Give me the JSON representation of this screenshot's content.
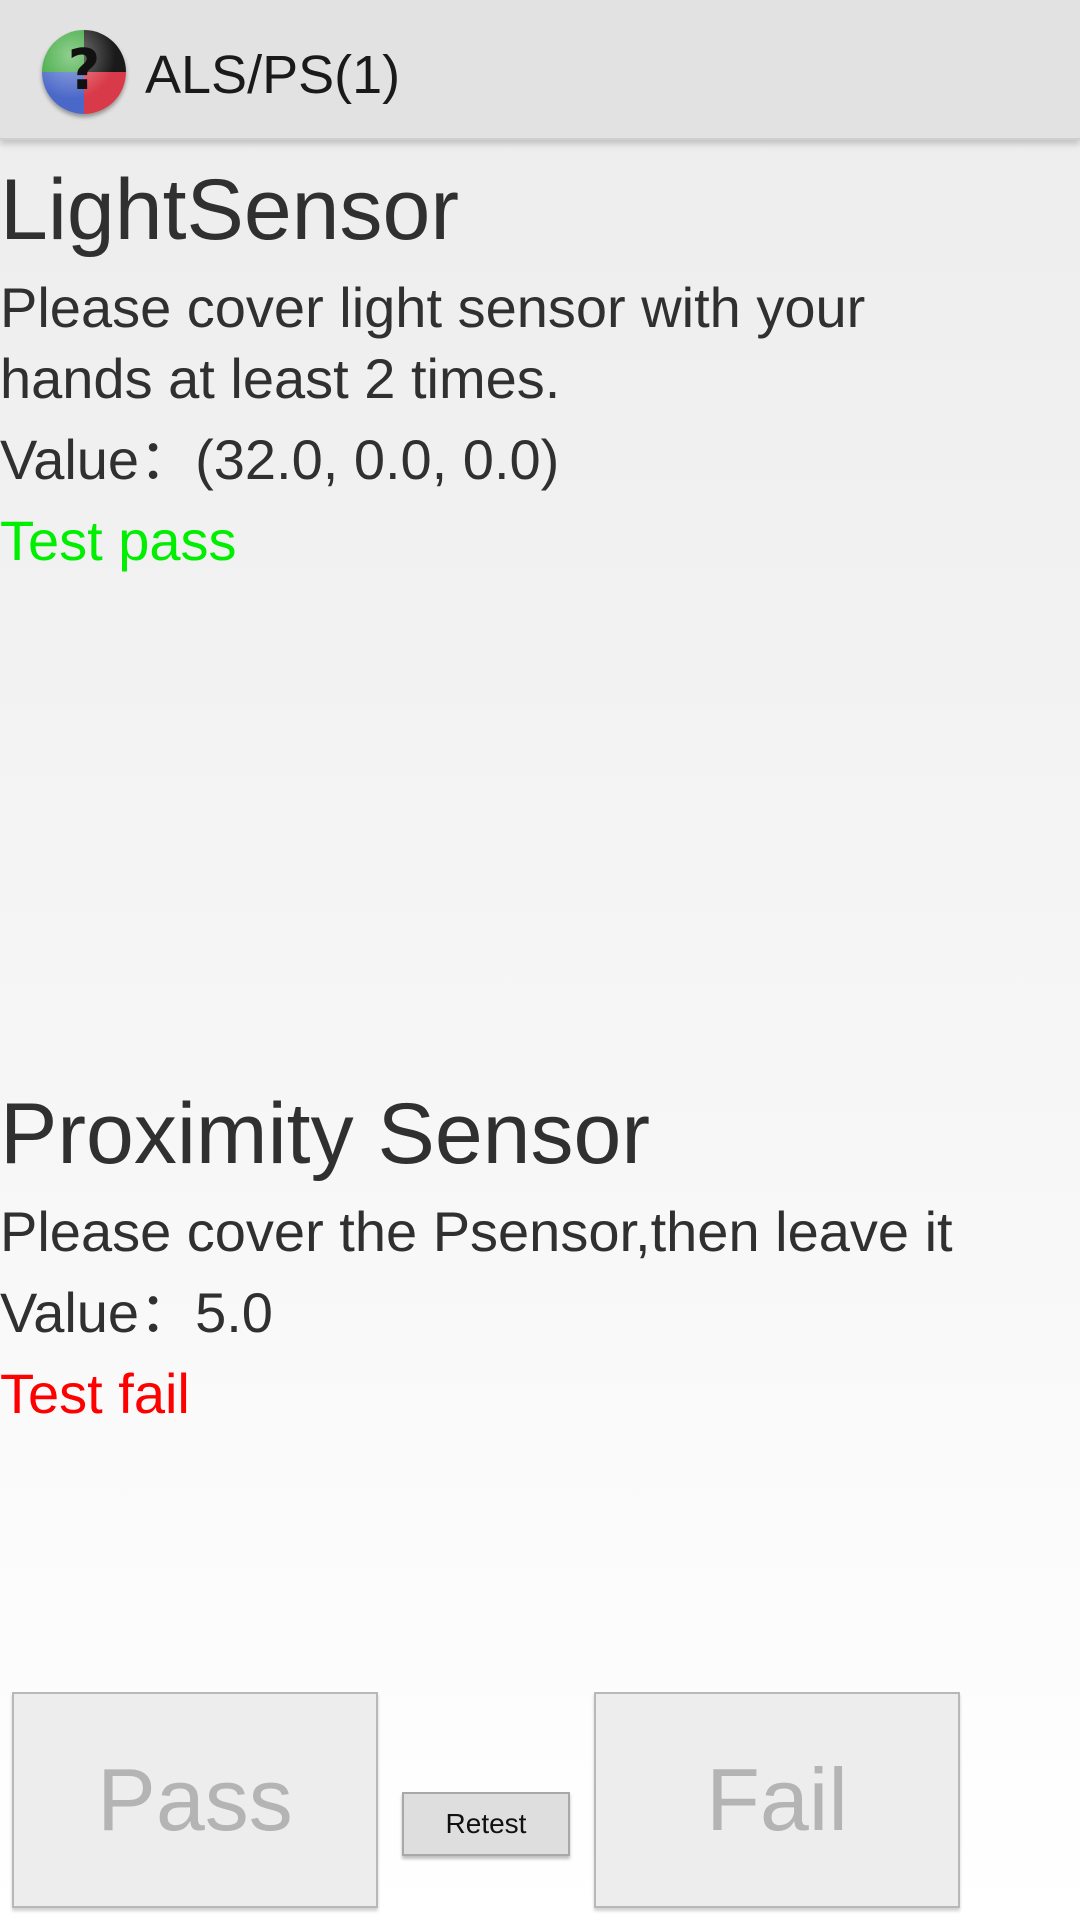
{
  "action_bar": {
    "title": "ALS/PS(1)",
    "icon": "help-sensor-app-icon",
    "icon_glyph": "?"
  },
  "light_sensor": {
    "heading": "LightSensor",
    "instruction_line1": "Please cover light sensor with your",
    "instruction_line2": "hands at least 2 times.",
    "value": "Value：(32.0, 0.0, 0.0)",
    "status": "Test pass",
    "status_color": "#00ee00"
  },
  "proximity_sensor": {
    "heading": "Proximity Sensor",
    "instruction": "Please cover the Psensor,then leave it",
    "value": "Value：5.0",
    "status": "Test fail",
    "status_color": "#ff0000"
  },
  "buttons": {
    "pass_label": "Pass",
    "retest_label": "Retest",
    "fail_label": "Fail"
  }
}
